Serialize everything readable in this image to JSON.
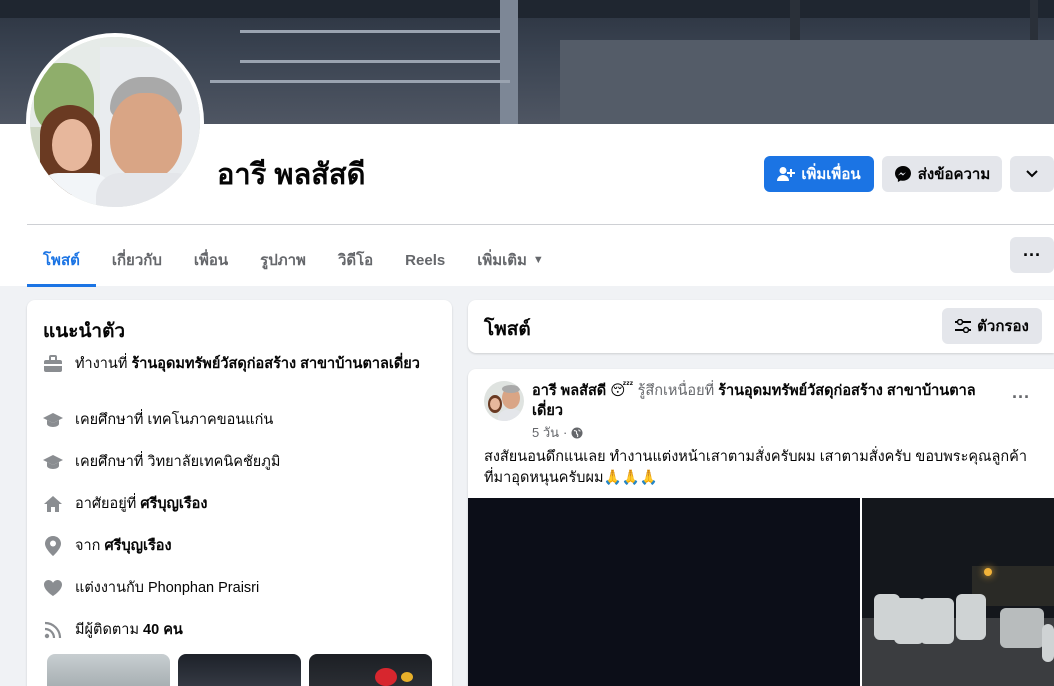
{
  "profile": {
    "name": "อารี พลสัสดี",
    "add_friend_label": "เพิ่มเพื่อน",
    "message_label": "ส่งข้อความ"
  },
  "tabs": [
    {
      "label": "โพสต์",
      "active": true
    },
    {
      "label": "เกี่ยวกับ"
    },
    {
      "label": "เพื่อน"
    },
    {
      "label": "รูปภาพ"
    },
    {
      "label": "วิดีโอ"
    },
    {
      "label": "Reels"
    },
    {
      "label": "เพิ่มเติม"
    }
  ],
  "intro": {
    "title": "แนะนำตัว",
    "work_prefix": "ทำงานที่",
    "work_place": "ร้านอุดมทรัพย์วัสดุก่อสร้าง สาขาบ้านตาลเดี่ยว",
    "edu1": "เคยศึกษาที่ เทคโนภาคขอนแก่น",
    "edu2": "เคยศึกษาที่ วิทยาลัยเทคนิคชัยภูมิ",
    "lives_prefix": "อาศัยอยู่ที่",
    "lives_place": "ศรีบุญเรือง",
    "from_prefix": "จาก",
    "from_place": "ศรีบุญเรือง",
    "married": "แต่งงานกับ Phonphan Praisri",
    "followers_prefix": "มีผู้ติดตาม",
    "followers_count": "40 คน"
  },
  "posts_section": {
    "title": "โพสต์",
    "filter_label": "ตัวกรอง"
  },
  "post": {
    "author": "อารี พลสัสดี",
    "emoji": "😴",
    "feeling": "รู้สึกเหนื่อยที่",
    "place": "ร้านอุดมทรัพย์วัสดุก่อสร้าง สาขาบ้านตาลเดี่ยว",
    "time": "5 วัน",
    "text": "สงสัยนอนดึกแนเลย  ทำงานแต่งหน้าเสาตามสั่งครับผม  เสาตามสั่งครับ   ขอบพระคุณลูกค้าที่มาอุดหนุนครับผม🙏🙏🙏"
  },
  "colors": {
    "accent": "#1b74e4",
    "background": "#f0f2f5",
    "secondary_button": "#e4e6eb"
  }
}
